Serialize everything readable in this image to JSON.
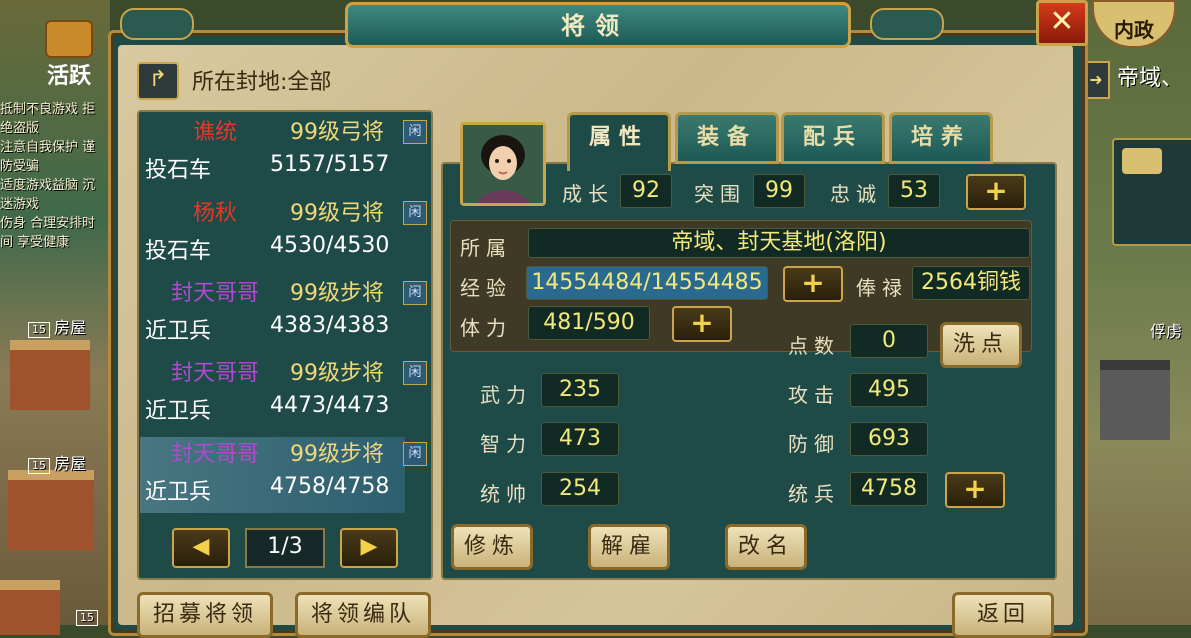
{
  "window": {
    "title": "将领",
    "close_label": "✕"
  },
  "top_right": {
    "neizheng": "内政"
  },
  "left_side": {
    "huoyue": "活跃",
    "notice_lines": [
      "抵制不良游戏 拒绝盗版",
      "注意自我保护 谨防受骗",
      "适度游戏益脑 沉迷游戏",
      "伤身 合理安排时间 享受健康"
    ],
    "house_labels": [
      {
        "lvl": "15",
        "name": "房屋"
      },
      {
        "lvl": "15",
        "name": "房屋"
      },
      {
        "lvl": "15",
        "name": ""
      }
    ]
  },
  "right_side": {
    "region": "帝域、",
    "house": "俘虏"
  },
  "fief": {
    "label": "所在封地:全部"
  },
  "generals": [
    {
      "name": "谯统",
      "name_color": "#e03a2a",
      "level": "99级弓将",
      "idle": "闲",
      "unit": "投石车",
      "count": "5157/5157"
    },
    {
      "name": "杨秋",
      "name_color": "#e03a2a",
      "level": "99级弓将",
      "idle": "闲",
      "unit": "投石车",
      "count": "4530/4530"
    },
    {
      "name": "封天哥哥",
      "name_color": "#b04ad0",
      "level": "99级步将",
      "idle": "闲",
      "unit": "近卫兵",
      "count": "4383/4383"
    },
    {
      "name": "封天哥哥",
      "name_color": "#b04ad0",
      "level": "99级步将",
      "idle": "闲",
      "unit": "近卫兵",
      "count": "4473/4473"
    },
    {
      "name": "封天哥哥",
      "name_color": "#b04ad0",
      "level": "99级步将",
      "idle": "闲",
      "unit": "近卫兵",
      "count": "4758/4758"
    }
  ],
  "pager": {
    "prev": "◀",
    "next": "▶",
    "page": "1/3"
  },
  "bottom_buttons": {
    "recruit": "招募将领",
    "formation": "将领编队",
    "back": "返回"
  },
  "tabs": [
    "属性",
    "装备",
    "配兵",
    "培养"
  ],
  "stats_top": {
    "growth_label": "成长",
    "growth": "92",
    "breakthrough_label": "突围",
    "breakthrough": "99",
    "loyalty_label": "忠诚",
    "loyalty": "53"
  },
  "info": {
    "belong_label": "所属",
    "belong": "帝域、封天基地(洛阳)",
    "exp_label": "经验",
    "exp": "14554484/14554485",
    "salary_label": "俸禄",
    "salary": "2564铜钱",
    "stamina_label": "体力",
    "stamina": "481/590",
    "points_label": "点数",
    "points": "0",
    "reset_label": "洗点"
  },
  "attributes": {
    "force_label": "武力",
    "force": "235",
    "intel_label": "智力",
    "intel": "473",
    "command_label": "统帅",
    "command": "254",
    "attack_label": "攻击",
    "attack": "495",
    "defense_label": "防御",
    "defense": "693",
    "troops_label": "统兵",
    "troops": "4758"
  },
  "actions": {
    "train": "修炼",
    "dismiss": "解雇",
    "rename": "改名"
  },
  "plus": "+",
  "colors": {
    "accent_gold": "#caa54a",
    "panel_teal": "#1e4a48",
    "value_yellow": "#f3e87a"
  }
}
